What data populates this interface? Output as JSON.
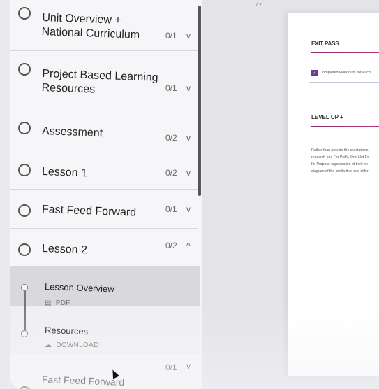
{
  "sidebar": {
    "sections": [
      {
        "title": "Unit Overview + National Curriculum",
        "count": "0/1",
        "chevron": "v"
      },
      {
        "title": "Project Based Learning Resources",
        "count": "0/1",
        "chevron": "v"
      },
      {
        "title": "Assessment",
        "count": "0/2",
        "chevron": "v"
      },
      {
        "title": "Lesson 1",
        "count": "0/2",
        "chevron": "v"
      },
      {
        "title": "Fast Feed Forward",
        "count": "0/1",
        "chevron": "v"
      },
      {
        "title": "Lesson 2",
        "count": "0/2",
        "chevron": "^"
      },
      {
        "title": "Fast Feed Forward",
        "count": "0/1",
        "chevron": "v"
      }
    ],
    "subitems": [
      {
        "title": "Lesson Overview",
        "type": "PDF"
      },
      {
        "title": "Resources",
        "type": "DOWNLOAD"
      }
    ]
  },
  "viewer": {
    "page_indicator": "/ 2"
  },
  "document": {
    "exit_heading": "EXIT PASS",
    "checkbox_text": "Completed Handouts for each",
    "level_heading": "LEVEL UP +",
    "paragraph": [
      "Rather than provide the six stations,",
      "research one For Profit, One Not Fo",
      "for Purpose organisation of their ch",
      "diagram of the similarities and differ"
    ]
  },
  "colors": {
    "accent": "#6d3c91",
    "rule": "#a8326f"
  }
}
